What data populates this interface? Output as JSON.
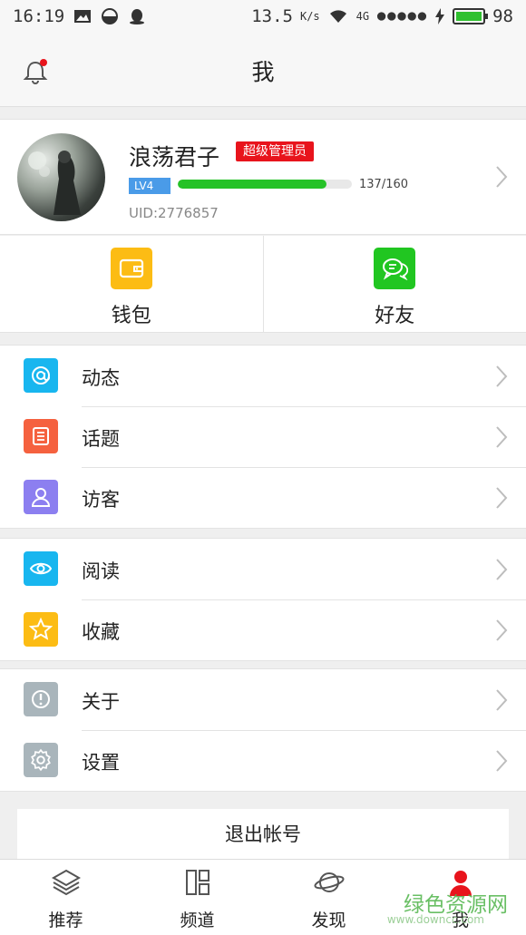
{
  "status_bar": {
    "time": "16:19",
    "net_speed": "13.5",
    "net_unit": "K/s",
    "network": "4G",
    "battery": "98",
    "battery_level": 0.98,
    "icons": [
      "image-icon",
      "half-circle-icon",
      "qq-icon",
      "wifi-icon",
      "signal-dots-icon",
      "charging-icon"
    ]
  },
  "header": {
    "title": "我",
    "notification_icon": "bell-icon",
    "has_unread": true
  },
  "profile": {
    "username": "浪荡君子",
    "role": "超级管理员",
    "level": "LV4",
    "exp_text": "137/160",
    "exp_progress": 0.856,
    "uid": "UID:2776857"
  },
  "quick": [
    {
      "label": "钱包",
      "icon": "wallet-icon",
      "color": "#fcbc14"
    },
    {
      "label": "好友",
      "icon": "chat-icon",
      "color": "#21c621"
    }
  ],
  "groups": [
    [
      {
        "label": "动态",
        "icon": "at-icon",
        "color": "#18b6ef"
      },
      {
        "label": "话题",
        "icon": "list-icon",
        "color": "#f5613f"
      },
      {
        "label": "访客",
        "icon": "person-icon",
        "color": "#8c7ff0"
      }
    ],
    [
      {
        "label": "阅读",
        "icon": "eye-icon",
        "color": "#18b6ef"
      },
      {
        "label": "收藏",
        "icon": "star-icon",
        "color": "#fcbc14"
      }
    ],
    [
      {
        "label": "关于",
        "icon": "info-icon",
        "color": "#a9b5bb"
      },
      {
        "label": "设置",
        "icon": "gear-icon",
        "color": "#a9b5bb"
      }
    ]
  ],
  "logout": {
    "label": "退出帐号"
  },
  "bottom_nav": [
    {
      "label": "推荐",
      "icon": "layers-icon",
      "active": false
    },
    {
      "label": "频道",
      "icon": "grid-icon",
      "active": false
    },
    {
      "label": "发现",
      "icon": "planet-icon",
      "active": false
    },
    {
      "label": "我",
      "icon": "person-icon",
      "active": true
    }
  ],
  "watermark": {
    "text": "绿色资源网",
    "sub": "www.downcc.com"
  }
}
